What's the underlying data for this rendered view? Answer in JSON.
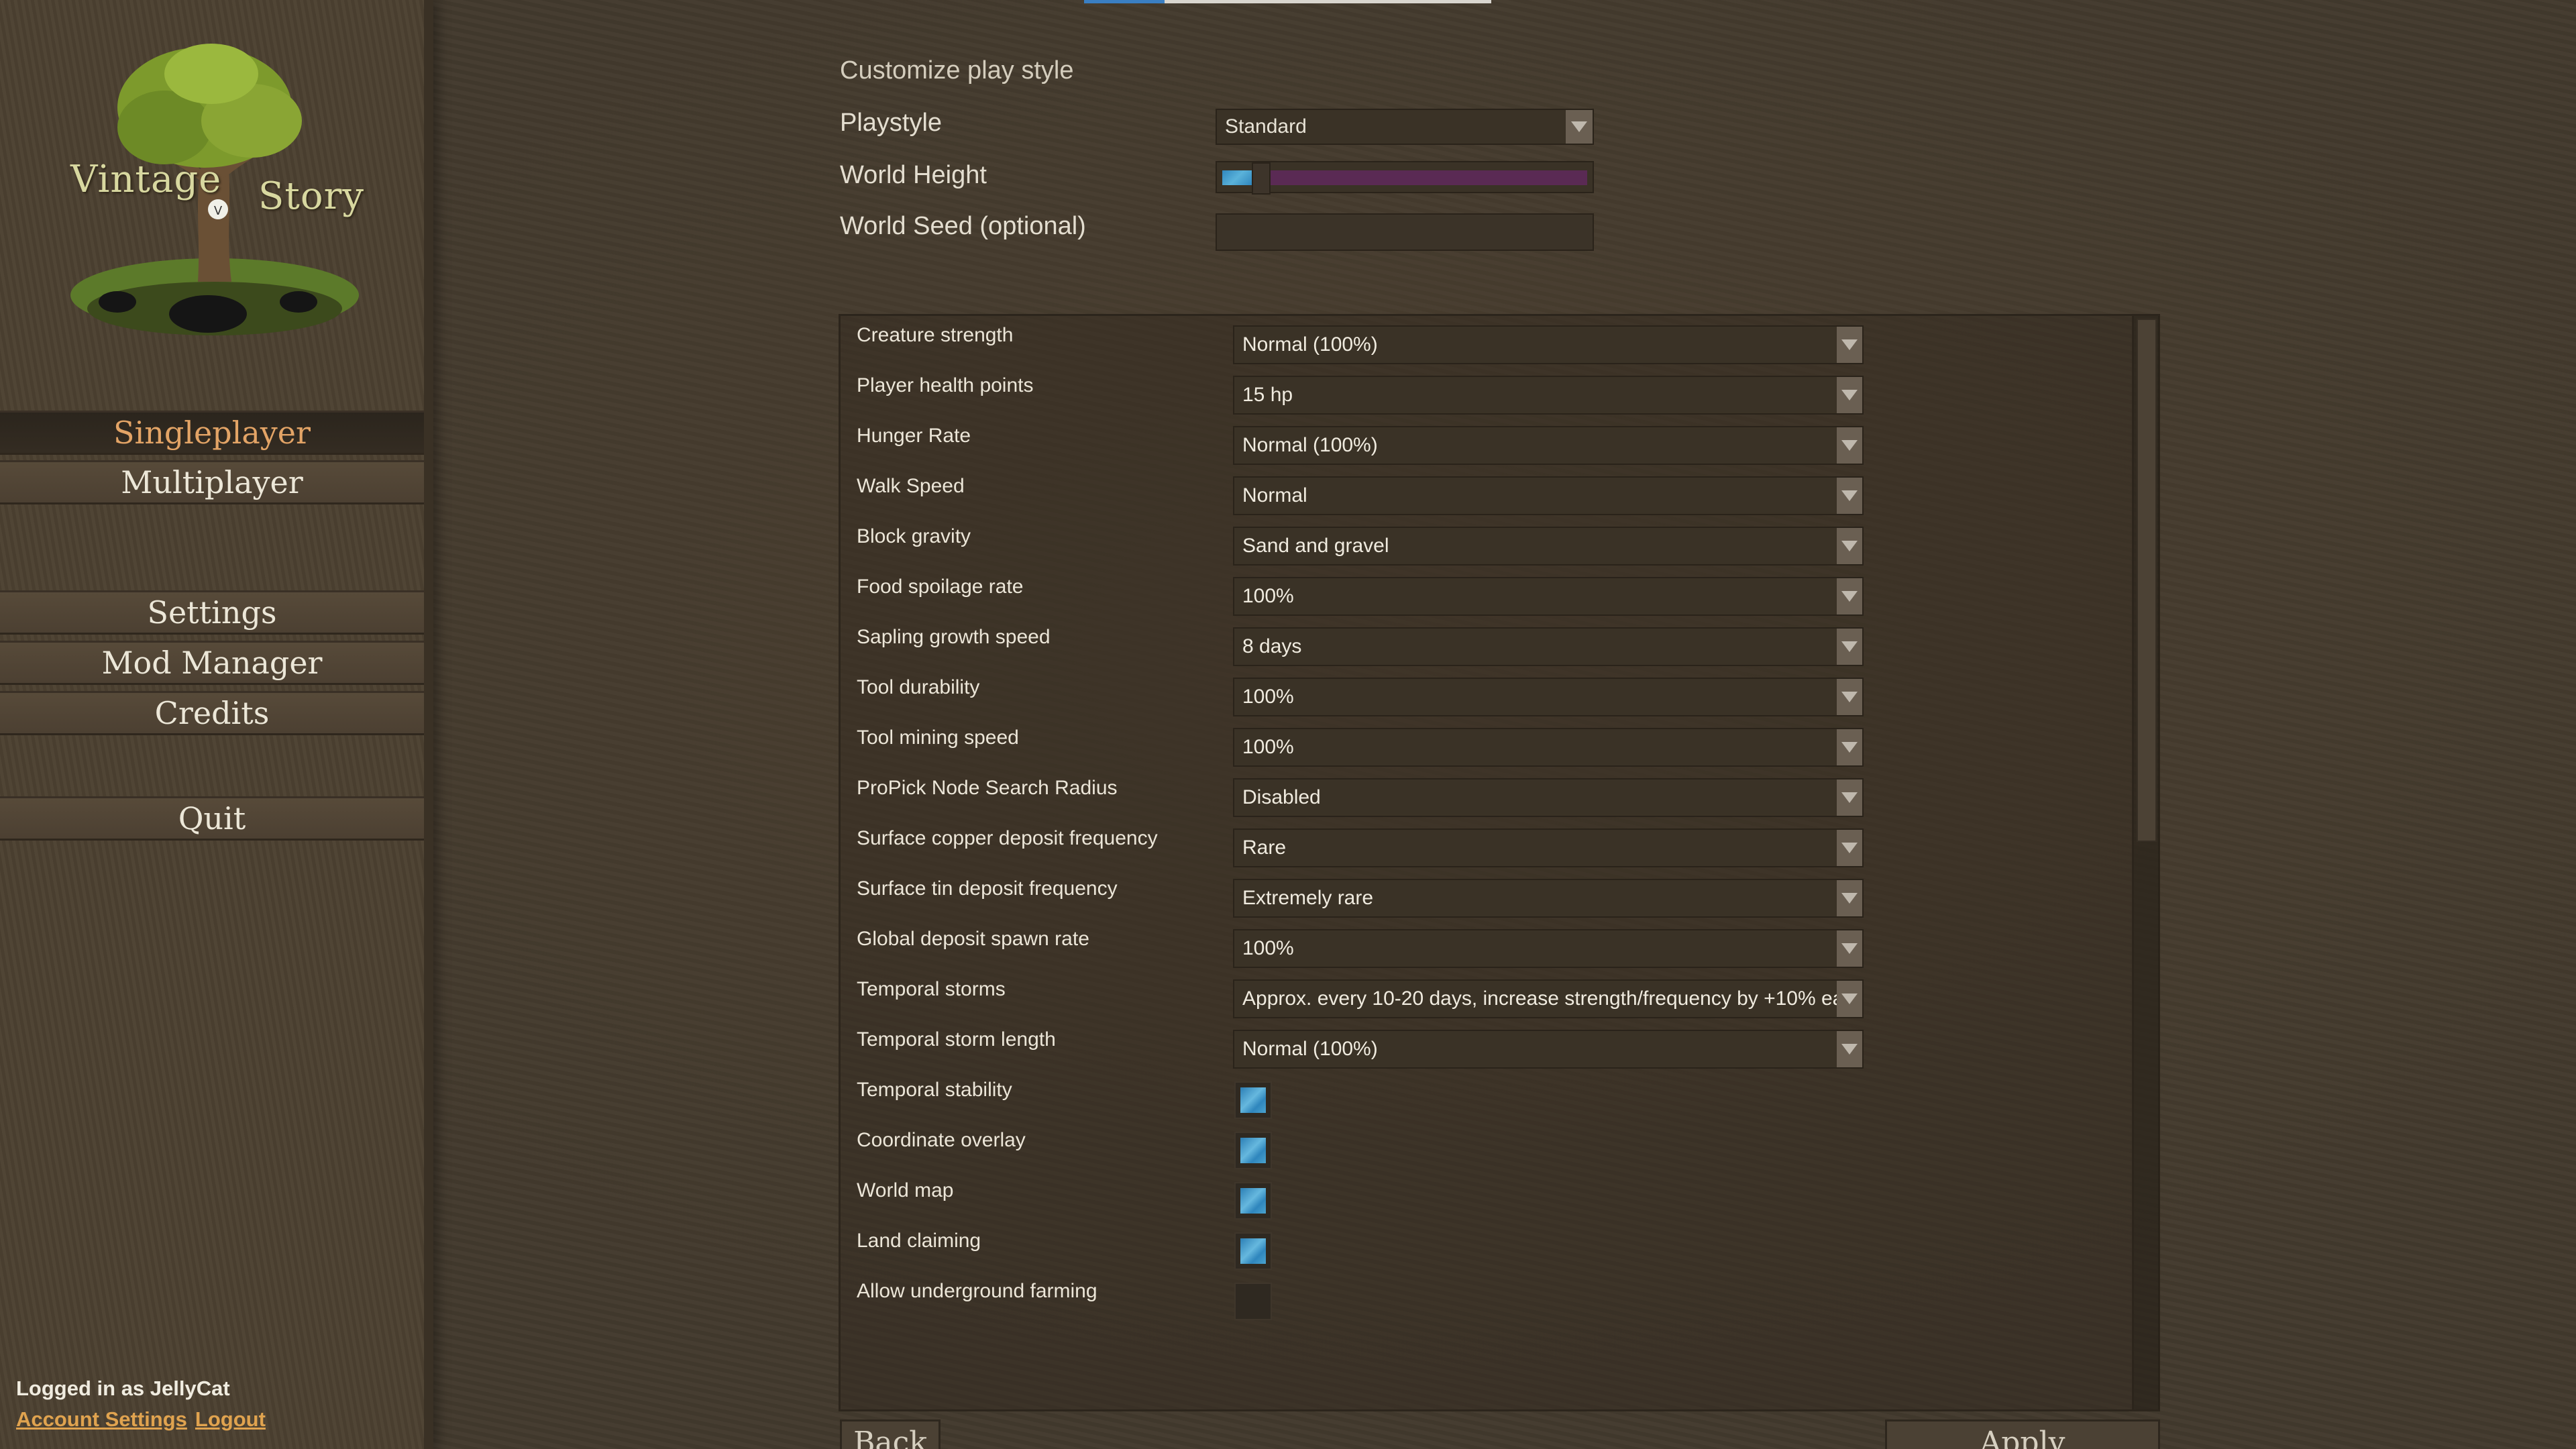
{
  "logo": {
    "word1": "Vintage",
    "word2": "Story"
  },
  "sidebar": {
    "items": [
      {
        "label": "Singleplayer",
        "active": true
      },
      {
        "label": "Multiplayer"
      },
      {
        "label": "Settings"
      },
      {
        "label": "Mod Manager"
      },
      {
        "label": "Credits"
      },
      {
        "label": "Quit"
      }
    ],
    "account": {
      "logged_in": "Logged in as JellyCat",
      "account_settings": "Account Settings",
      "logout": "Logout"
    }
  },
  "header": {
    "section_title": "Customize play style",
    "playstyle_label": "Playstyle",
    "playstyle_value": "Standard",
    "world_height_label": "World Height",
    "world_seed_label": "World Seed (optional)",
    "world_seed_value": ""
  },
  "settings": {
    "rows": [
      {
        "label": "Creature strength",
        "value": "Normal (100%)"
      },
      {
        "label": "Player health points",
        "value": "15 hp"
      },
      {
        "label": "Hunger Rate",
        "value": "Normal (100%)"
      },
      {
        "label": "Walk Speed",
        "value": "Normal"
      },
      {
        "label": "Block gravity",
        "value": "Sand and gravel"
      },
      {
        "label": "Food spoilage rate",
        "value": "100%"
      },
      {
        "label": "Sapling growth speed",
        "value": "8 days"
      },
      {
        "label": "Tool durability",
        "value": "100%"
      },
      {
        "label": "Tool mining speed",
        "value": "100%"
      },
      {
        "label": "ProPick Node Search Radius",
        "value": "Disabled"
      },
      {
        "label": "Surface copper deposit frequency",
        "value": "Rare"
      },
      {
        "label": "Surface tin deposit frequency",
        "value": "Extremely rare"
      },
      {
        "label": "Global deposit spawn rate",
        "value": "100%"
      },
      {
        "label": "Temporal storms",
        "value": "Approx. every 10-20 days, increase strength/frequency by +10% ea"
      },
      {
        "label": "Temporal storm length",
        "value": "Normal (100%)"
      }
    ],
    "toggles": [
      {
        "label": "Temporal stability",
        "checked": true
      },
      {
        "label": "Coordinate overlay",
        "checked": true
      },
      {
        "label": "World map",
        "checked": true
      },
      {
        "label": "Land claiming",
        "checked": true
      },
      {
        "label": "Allow underground farming",
        "checked": false
      }
    ]
  },
  "buttons": {
    "back": "Back",
    "apply": "Apply"
  },
  "colors": {
    "accent": "#e3a466",
    "checkbox_blue": "#3a8fc4",
    "slider_track": "#5a2a54"
  }
}
